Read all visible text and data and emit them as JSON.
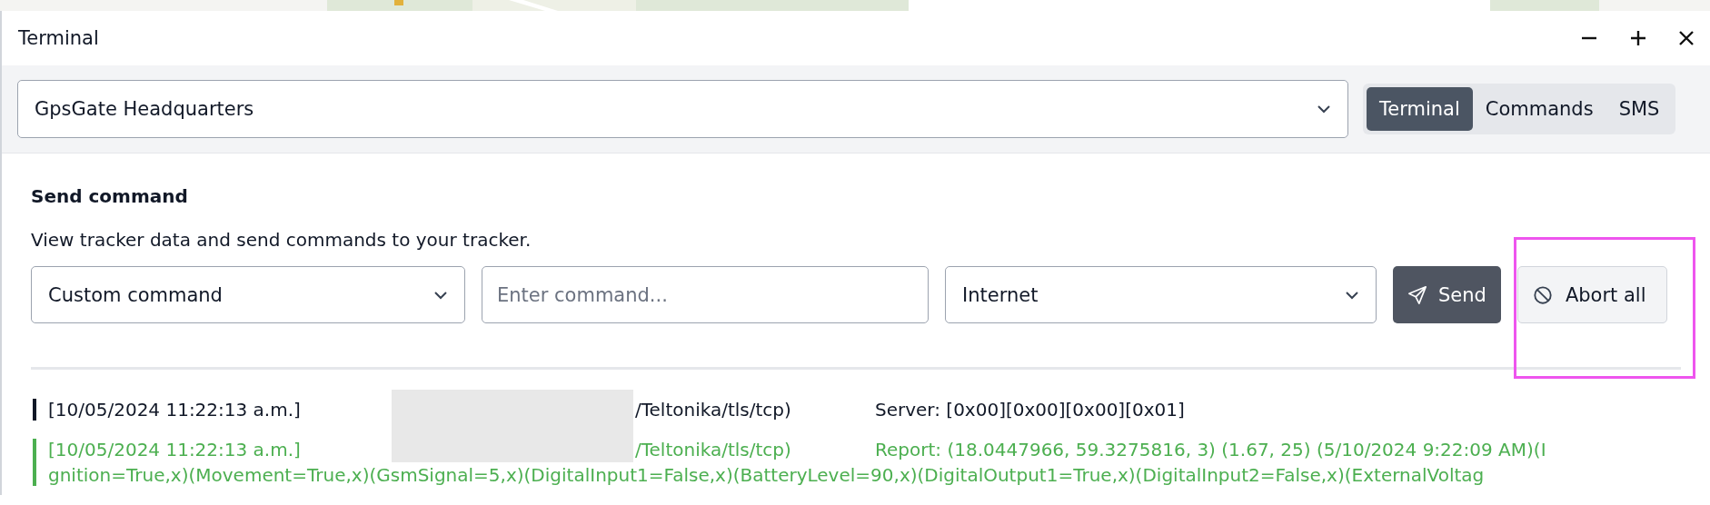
{
  "window": {
    "title": "Terminal"
  },
  "header": {
    "device_select": {
      "value": "GpsGate Headquarters"
    },
    "tabs": [
      {
        "label": "Terminal",
        "selected": true
      },
      {
        "label": "Commands",
        "selected": false
      },
      {
        "label": "SMS",
        "selected": false
      }
    ]
  },
  "send_command": {
    "heading": "Send command",
    "description": "View tracker data and send commands to your tracker.",
    "command_select": {
      "value": "Custom command"
    },
    "command_input": {
      "placeholder": "Enter command..."
    },
    "channel_select": {
      "value": "Internet"
    },
    "send_button": "Send",
    "abort_button": "Abort all",
    "abort_highlighted": true
  },
  "log": [
    {
      "color": "#111827",
      "timestamp": "[10/05/2024 11:22:13 a.m.]",
      "redacted": true,
      "source": "/Teltonika/tls/tcp)",
      "message": "Server: [0x00][0x00][0x00][0x01]"
    },
    {
      "color": "#4caf50",
      "timestamp": "[10/05/2024 11:22:13 a.m.]",
      "redacted": true,
      "source": "/Teltonika/tls/tcp)",
      "message": "Report: (18.0447966, 59.3275816, 3) (1.67, 25) (5/10/2024 9:22:09 AM)(I",
      "continuation": "gnition=True,x)(Movement=True,x)(GsmSignal=5,x)(DigitalInput1=False,x)(BatteryLevel=90,x)(DigitalOutput1=True,x)(DigitalInput2=False,x)(ExternalVoltag"
    }
  ]
}
